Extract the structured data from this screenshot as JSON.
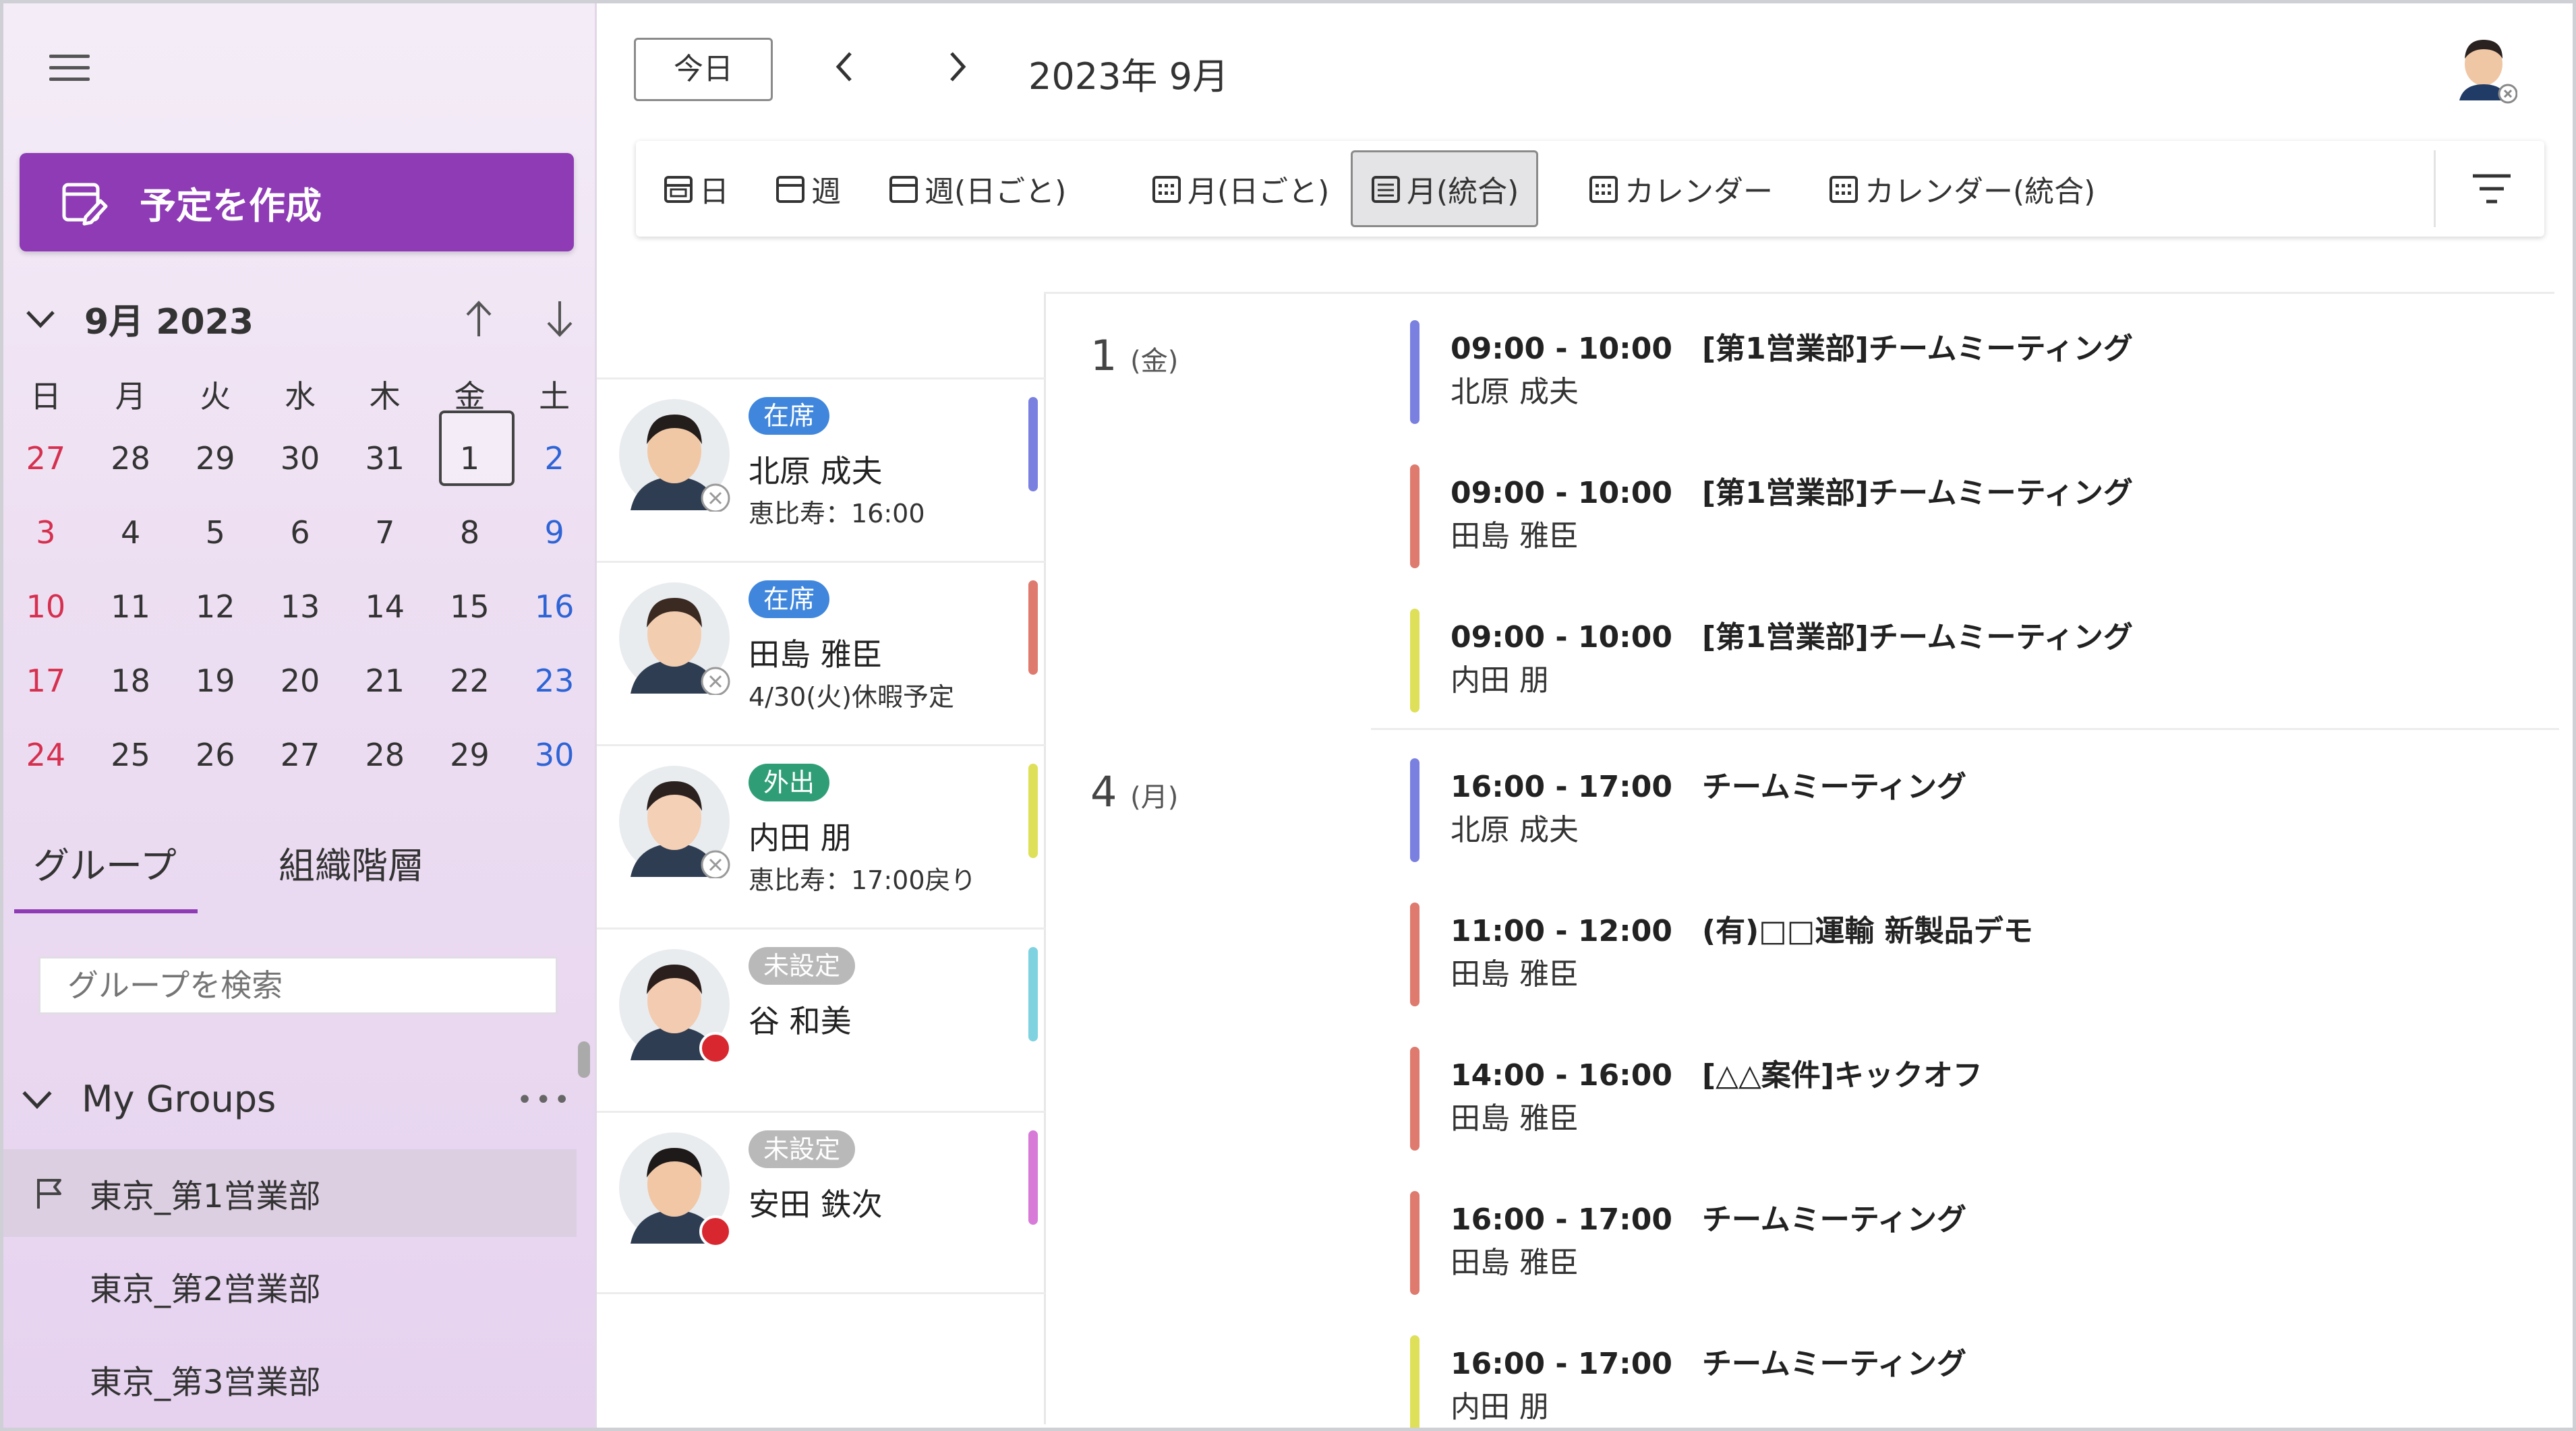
{
  "sidebar": {
    "create_label": "予定を作成",
    "mini_title": "9月 2023",
    "dow": [
      "日",
      "月",
      "火",
      "水",
      "木",
      "金",
      "土"
    ],
    "weeks": [
      [
        "27",
        "28",
        "29",
        "30",
        "31",
        "1",
        "2"
      ],
      [
        "3",
        "4",
        "5",
        "6",
        "7",
        "8",
        "9"
      ],
      [
        "10",
        "11",
        "12",
        "13",
        "14",
        "15",
        "16"
      ],
      [
        "17",
        "18",
        "19",
        "20",
        "21",
        "22",
        "23"
      ],
      [
        "24",
        "25",
        "26",
        "27",
        "28",
        "29",
        "30"
      ]
    ],
    "selected_day": "1",
    "tabs": [
      "グループ",
      "組織階層"
    ],
    "search_placeholder": "グループを検索",
    "mygroups_label": "My Groups",
    "mygroups_more": "•••",
    "groups": [
      "東京_第1営業部",
      "東京_第2営業部",
      "東京_第3営業部"
    ]
  },
  "header": {
    "today_label": "今日",
    "month_title": "2023年 9月"
  },
  "views": [
    "日",
    "週",
    "週(日ごと)",
    "月(日ごと)",
    "月(統合)",
    "カレンダー",
    "カレンダー(統合)"
  ],
  "active_view": "月(統合)",
  "people": [
    {
      "status": "在席",
      "status_color": "#3f86dc",
      "name": "北原 成夫",
      "sub": "恵比寿：16:00",
      "color": "#7a80e0",
      "presence": "offline"
    },
    {
      "status": "在席",
      "status_color": "#3f86dc",
      "name": "田島 雅臣",
      "sub": "4/30(火)休暇予定",
      "color": "#de7a6e",
      "presence": "offline"
    },
    {
      "status": "外出",
      "status_color": "#2f9e77",
      "name": "内田 朋",
      "sub": "恵比寿：17:00戻り",
      "color": "#dfe05a",
      "presence": "offline"
    },
    {
      "status": "未設定",
      "status_color": "#b9b9b9",
      "name": "谷 和美",
      "sub": "",
      "color": "#7fd2df",
      "presence": "busy"
    },
    {
      "status": "未設定",
      "status_color": "#b9b9b9",
      "name": "安田 鉄次",
      "sub": "",
      "color": "#d77ad8",
      "presence": "busy"
    }
  ],
  "days": [
    {
      "day": "1",
      "dow": "(金)",
      "events": [
        {
          "time_title": "09:00 - 10:00　[第1営業部]チームミーティング",
          "owner": "北原 成夫",
          "color": "#7a80e0"
        },
        {
          "time_title": "09:00 - 10:00　[第1営業部]チームミーティング",
          "owner": "田島 雅臣",
          "color": "#de7a6e"
        },
        {
          "time_title": "09:00 - 10:00　[第1営業部]チームミーティング",
          "owner": "内田 朋",
          "color": "#dfe05a"
        }
      ]
    },
    {
      "day": "4",
      "dow": "(月)",
      "events": [
        {
          "time_title": "16:00 - 17:00　チームミーティング",
          "owner": "北原 成夫",
          "color": "#7a80e0"
        },
        {
          "time_title": "11:00 - 12:00　(有)□□運輸 新製品デモ",
          "owner": "田島 雅臣",
          "color": "#de7a6e"
        },
        {
          "time_title": "14:00 - 16:00　[△△案件]キックオフ",
          "owner": "田島 雅臣",
          "color": "#de7a6e"
        },
        {
          "time_title": "16:00 - 17:00　チームミーティング",
          "owner": "田島 雅臣",
          "color": "#de7a6e"
        },
        {
          "time_title": "16:00 - 17:00　チームミーティング",
          "owner": "内田 朋",
          "color": "#dfe05a"
        }
      ]
    }
  ],
  "colors": {
    "accent": "#8e3bb5",
    "busy": "#d8272f"
  }
}
